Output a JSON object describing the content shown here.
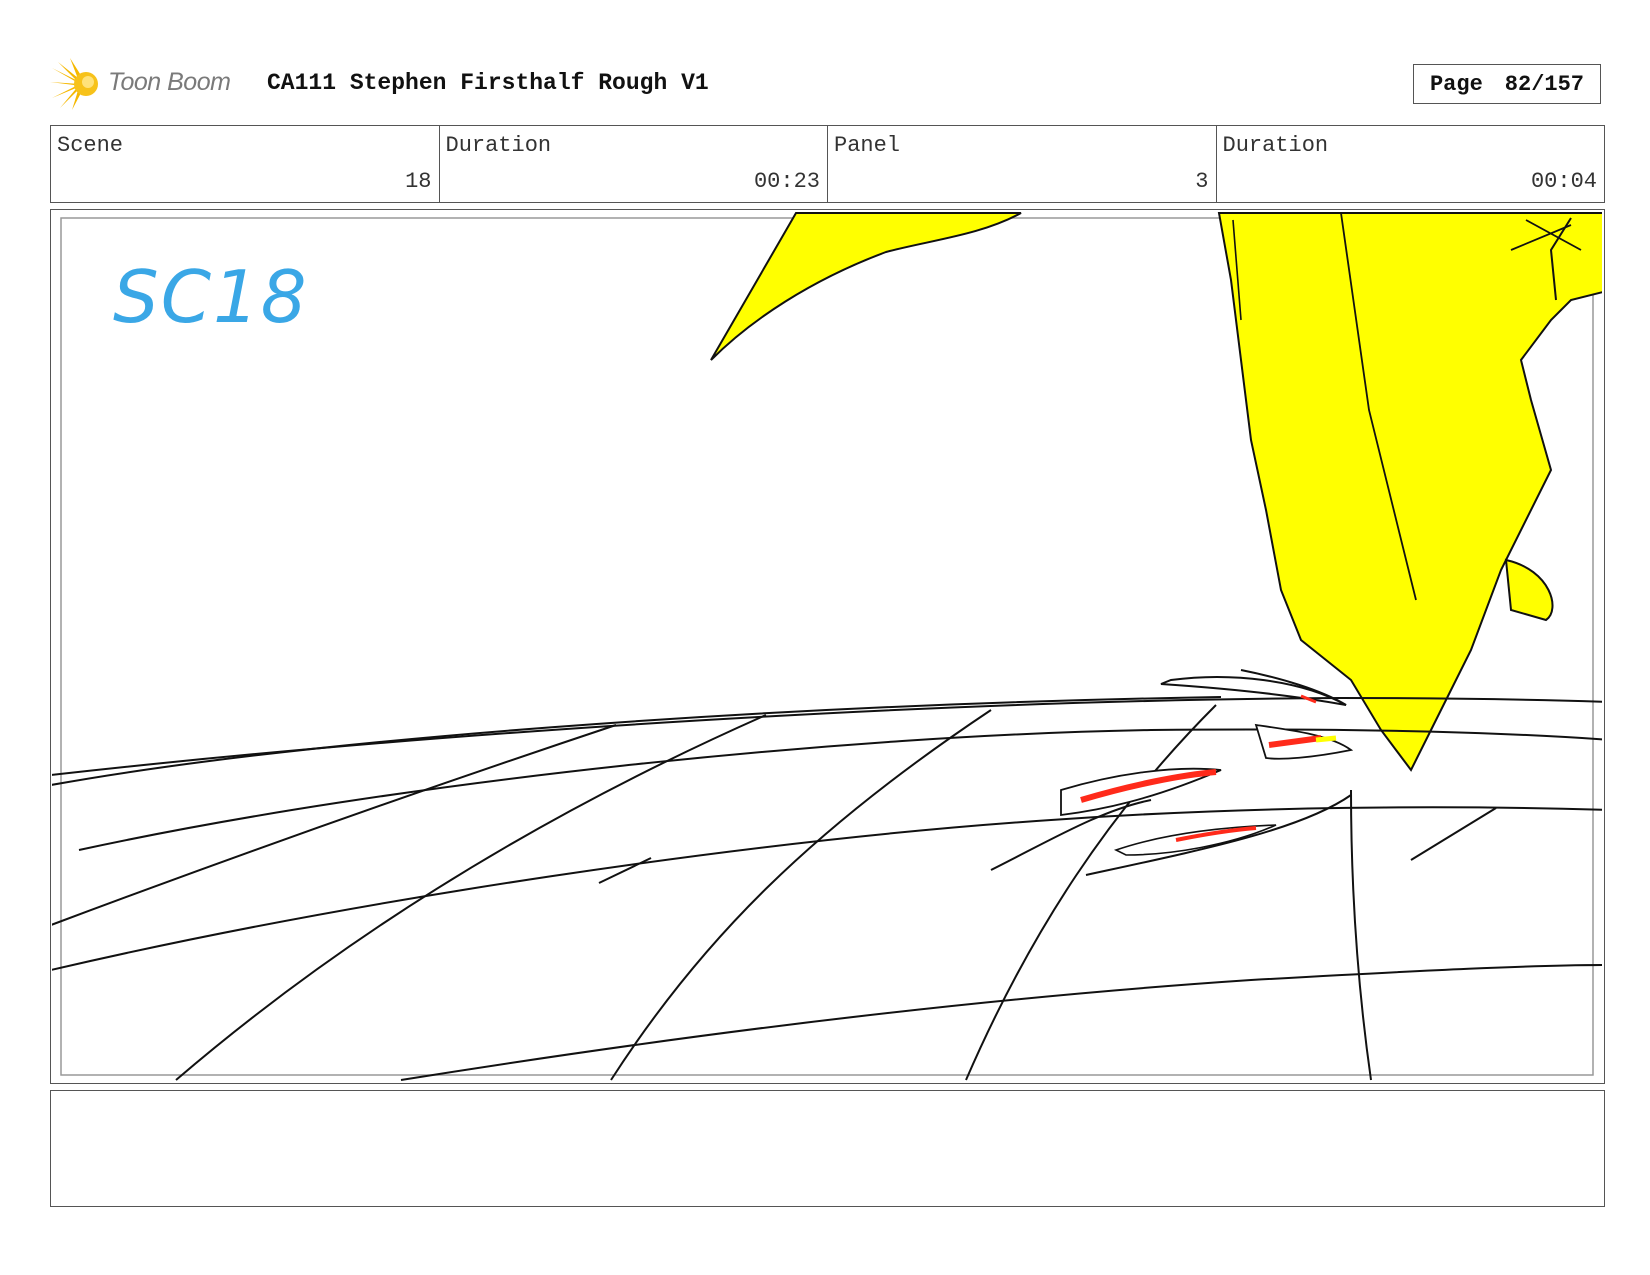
{
  "header": {
    "logo_text": "Toon Boom",
    "title": "CA111 Stephen Firsthalf Rough V1",
    "page_label": "Page",
    "page_value": "82/157"
  },
  "info": {
    "scene_label": "Scene",
    "scene_value": "18",
    "scene_duration_label": "Duration",
    "scene_duration_value": "00:23",
    "panel_label": "Panel",
    "panel_value": "3",
    "panel_duration_label": "Duration",
    "panel_duration_value": "00:04"
  },
  "panel": {
    "annotation": "SC18",
    "annotation_color": "#3aa7e6",
    "fill_color": "#ffff00",
    "accent_color": "#ff2a1a"
  },
  "notes": {
    "text": ""
  }
}
